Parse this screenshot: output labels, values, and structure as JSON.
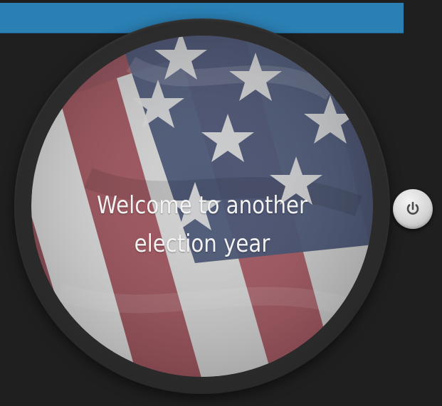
{
  "app": {
    "message": {
      "line1": "Welcome to another",
      "line2": "election year"
    },
    "icons": {
      "background": "us-flag-background",
      "power": "power-icon"
    },
    "colors": {
      "topBar": "#2a7fb3",
      "appBackground": "#1f1f1f",
      "watchBezel": "#2b2b2b",
      "messageText": "#f2f2f2",
      "flagRed": "#8e4a54",
      "flagWhite": "#d3d3d3",
      "flagBlue": "#3d4b6b"
    }
  }
}
